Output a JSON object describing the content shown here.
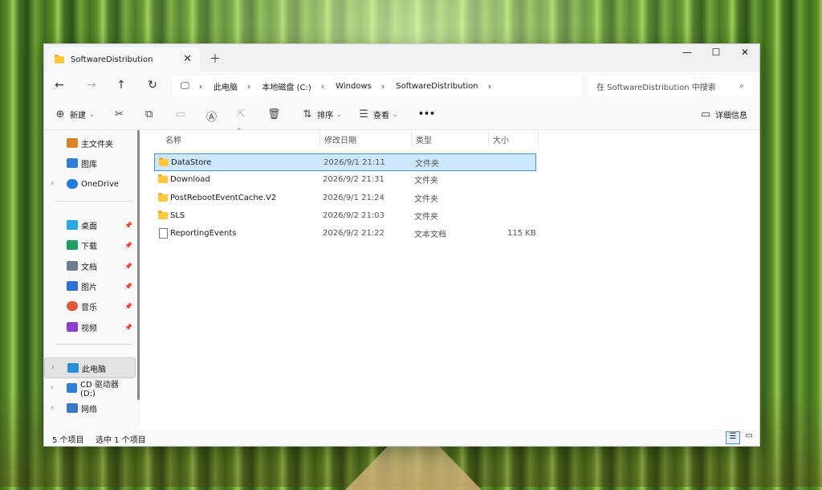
{
  "tab": {
    "title": "SoftwareDistribution"
  },
  "address": {
    "crumbs": [
      "此电脑",
      "本地磁盘 (C:)",
      "Windows",
      "SoftwareDistribution"
    ]
  },
  "search": {
    "placeholder": "在 SoftwareDistribution 中搜索"
  },
  "toolbar": {
    "new_label": "新建",
    "sort_label": "排序",
    "view_label": "查看",
    "more_label": "•••",
    "details_label": "详细信息"
  },
  "sidebar": {
    "items": [
      {
        "label": "主文件夹",
        "color": "#d9822b"
      },
      {
        "label": "图库",
        "color": "#2f7fd8"
      },
      {
        "label": "OneDrive",
        "color": "#1f7de0"
      },
      {
        "label": "桌面",
        "color": "#2aa7e0"
      },
      {
        "label": "下载",
        "color": "#20a060"
      },
      {
        "label": "文档",
        "color": "#6b7c93"
      },
      {
        "label": "图片",
        "color": "#2f6fd8"
      },
      {
        "label": "音乐",
        "color": "#e05a3a"
      },
      {
        "label": "视频",
        "color": "#8a3fd1"
      },
      {
        "label": "此电脑",
        "color": "#2a8fd8"
      },
      {
        "label": "CD 驱动器 (D:)",
        "color": "#2f7fd8"
      },
      {
        "label": "网络",
        "color": "#3a78c8"
      }
    ]
  },
  "columns": {
    "name": "名称",
    "modified": "修改日期",
    "type": "类型",
    "size": "大小"
  },
  "files": [
    {
      "name": "DataStore",
      "modified": "2026/9/1 21:11",
      "type": "文件夹",
      "size": ""
    },
    {
      "name": "Download",
      "modified": "2026/9/2 21:31",
      "type": "文件夹",
      "size": ""
    },
    {
      "name": "PostRebootEventCache.V2",
      "modified": "2026/9/1 21:24",
      "type": "文件夹",
      "size": ""
    },
    {
      "name": "SLS",
      "modified": "2026/9/2 21:03",
      "type": "文件夹",
      "size": ""
    },
    {
      "name": "ReportingEvents",
      "modified": "2026/9/2 21:22",
      "type": "文本文档",
      "size": "115 KB"
    }
  ],
  "status": {
    "count": "5 个项目",
    "selected": "选中 1 个项目"
  }
}
